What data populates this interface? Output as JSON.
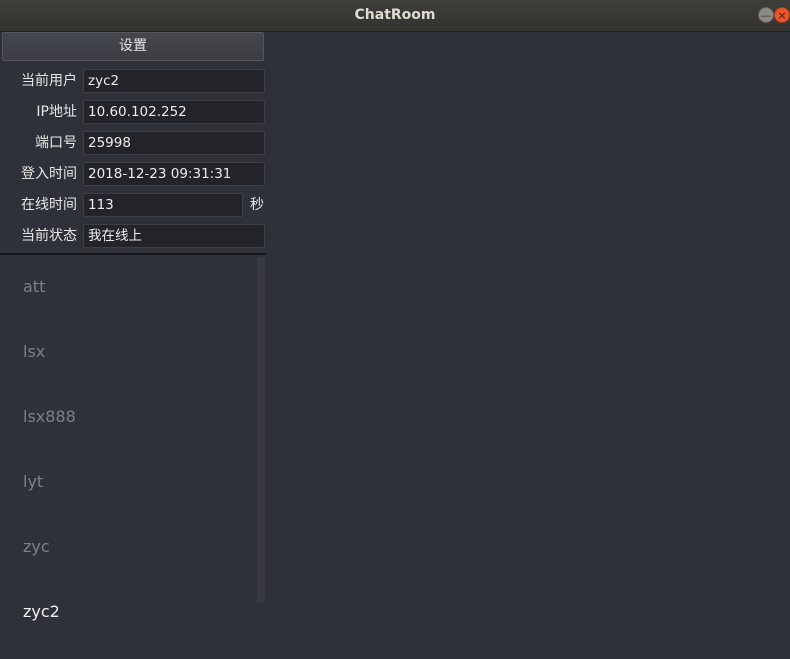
{
  "window": {
    "title": "ChatRoom",
    "minimize_icon": "—",
    "close_icon": "×"
  },
  "settings": {
    "button_label": "设置"
  },
  "info": {
    "current_user_label": "当前用户",
    "current_user_value": "zyc2",
    "ip_label": "IP地址",
    "ip_value": "10.60.102.252",
    "port_label": "端口号",
    "port_value": "25998",
    "login_time_label": "登入时间",
    "login_time_value": "2018-12-23 09:31:31",
    "online_time_label": "在线时间",
    "online_time_value": "113",
    "online_time_unit": "秒",
    "status_label": "当前状态",
    "status_value": "我在线上"
  },
  "users": [
    "att",
    "lsx",
    "lsx888",
    "lyt",
    "zyc",
    "zyc2"
  ],
  "active_user": "zyc2"
}
